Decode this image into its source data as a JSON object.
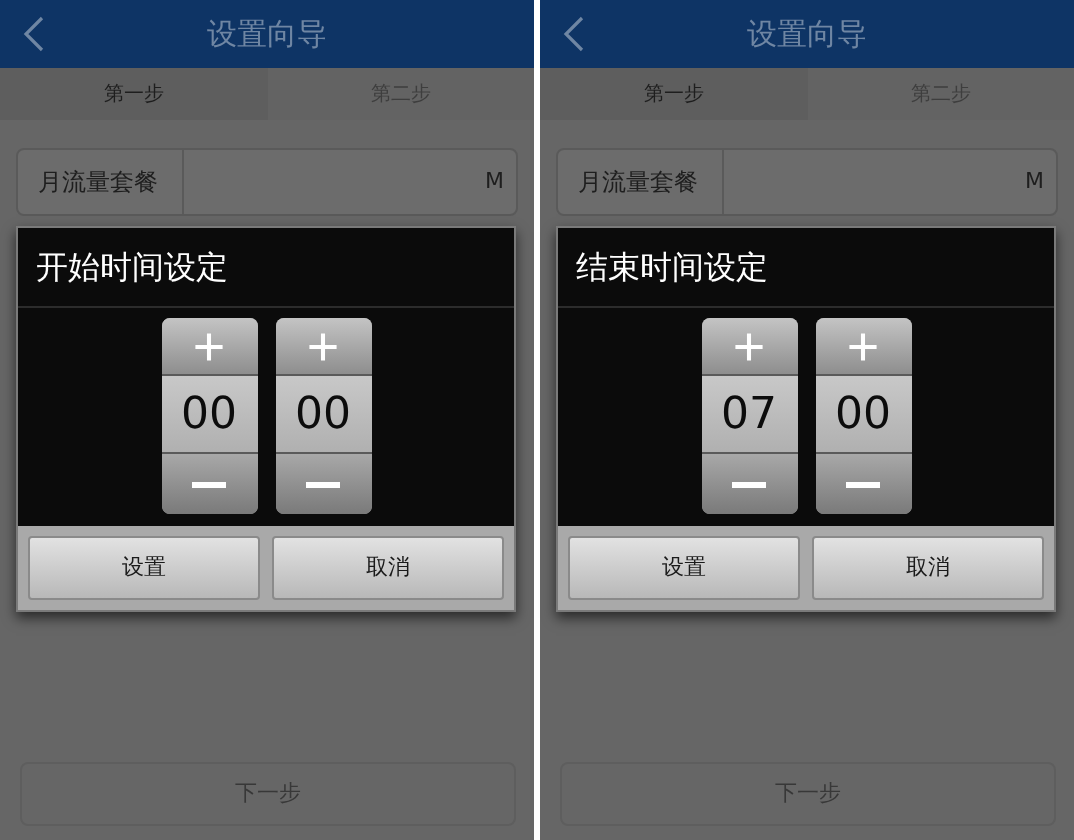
{
  "screens": [
    {
      "header": {
        "title": "设置向导"
      },
      "steps": [
        {
          "label": "第一步",
          "selected": true
        },
        {
          "label": "第二步",
          "selected": false
        }
      ],
      "rows": [
        {
          "label": "月流量套餐",
          "value": "M"
        }
      ],
      "dialog": {
        "title": "开始时间设定",
        "spinners": [
          {
            "value": "00"
          },
          {
            "value": "00"
          }
        ],
        "buttons": [
          "设置",
          "取消"
        ]
      },
      "next_button": {
        "label": "下一步",
        "disabled": true
      }
    },
    {
      "header": {
        "title": "设置向导"
      },
      "steps": [
        {
          "label": "第一步",
          "selected": true
        },
        {
          "label": "第二步",
          "selected": false
        }
      ],
      "rows": [
        {
          "label": "月流量套餐",
          "value": "M"
        }
      ],
      "dialog": {
        "title": "结束时间设定",
        "spinners": [
          {
            "value": "07"
          },
          {
            "value": "00"
          }
        ],
        "buttons": [
          "设置",
          "取消"
        ]
      },
      "next_button": {
        "label": "下一步",
        "disabled": true
      }
    }
  ]
}
